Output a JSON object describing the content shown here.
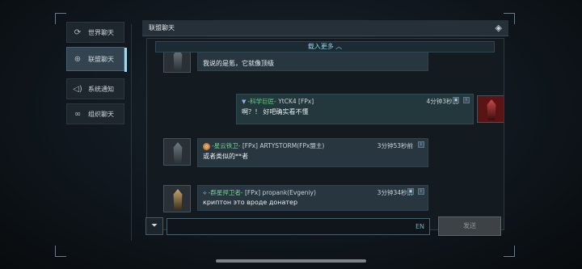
{
  "sidebar": {
    "items": [
      {
        "label": "世界聊天",
        "icon": "refresh-globe-icon"
      },
      {
        "label": "联盟聊天",
        "icon": "globe-icon"
      },
      {
        "label": "系统通知",
        "icon": "speaker-icon"
      },
      {
        "label": "组织聊天",
        "icon": "link-icon"
      }
    ],
    "active_index": 1
  },
  "panel": {
    "title": "联盟聊天",
    "header_icon": "diamond-icon",
    "load_more": "载入更多 ︿"
  },
  "messages": [
    {
      "id": "m1",
      "name_tag": "",
      "name_rest": "",
      "time": "",
      "text": "我说的是氪，它就像顶级"
    },
    {
      "id": "m2",
      "name_tag": "-科学巨匠-",
      "name_rest": "YtCK4 [FPx]",
      "time": "4分钟3秒前",
      "text": "啊？！ 好吧确实看不懂",
      "mine": true
    },
    {
      "id": "m3",
      "name_tag": "-星云铁卫-",
      "name_rest": "[FPx] ARTYSTORM(FPx盟主)",
      "time": "3分钟53秒前",
      "text": "或者类似的**者"
    },
    {
      "id": "m4",
      "name_tag": "-群星捍卫者-",
      "name_rest": "[FPx] propank(Evgeniy)",
      "time": "3分钟34秒前",
      "text": "криптон это вроде донатер"
    }
  ],
  "input": {
    "value": "",
    "placeholder": "",
    "lang": "EN"
  },
  "send_label": "发送",
  "colors": {
    "accent": "#9fd8ee",
    "name_tag": "#6fcf8f",
    "bubble": "#283640"
  }
}
